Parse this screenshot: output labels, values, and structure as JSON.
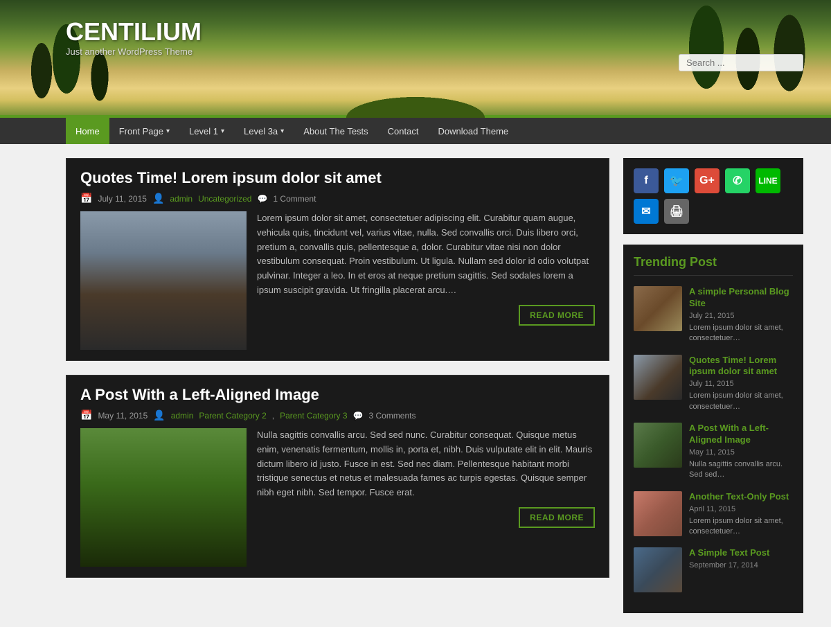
{
  "site": {
    "title": "CENTILIUM",
    "tagline": "Just another WordPress Theme"
  },
  "header": {
    "search_placeholder": "Search ..."
  },
  "nav": {
    "items": [
      {
        "label": "Home",
        "active": true,
        "has_arrow": false
      },
      {
        "label": "Front Page",
        "active": false,
        "has_arrow": true
      },
      {
        "label": "Level 1",
        "active": false,
        "has_arrow": true
      },
      {
        "label": "Level 3a",
        "active": false,
        "has_arrow": true
      },
      {
        "label": "About The Tests",
        "active": false,
        "has_arrow": false
      },
      {
        "label": "Contact",
        "active": false,
        "has_arrow": false
      },
      {
        "label": "Download Theme",
        "active": false,
        "has_arrow": false
      }
    ]
  },
  "posts": [
    {
      "title": "Quotes Time! Lorem ipsum dolor sit amet",
      "date": "July 11, 2015",
      "author": "admin",
      "category": "Uncategorized",
      "comments": "1 Comment",
      "excerpt": "Lorem ipsum dolor sit amet, consectetuer adipiscing elit. Curabitur quam augue, vehicula quis, tincidunt vel, varius vitae, nulla. Sed convallis orci. Duis libero orci, pretium a, convallis quis, pellentesque a, dolor. Curabitur vitae nisi non dolor vestibulum consequat. Proin vestibulum. Ut ligula. Nullam sed dolor id odio volutpat pulvinar. Integer a leo. In et eros at neque pretium sagittis. Sed sodales lorem a ipsum suscipit gravida. Ut fringilla placerat arcu.…",
      "read_more": "READ MORE",
      "image_class": "img-woman"
    },
    {
      "title": "A Post With a Left-Aligned Image",
      "date": "May 11, 2015",
      "author": "admin",
      "category1": "Parent Category 2",
      "category2": "Parent Category 3",
      "comments": "3 Comments",
      "excerpt": "Nulla sagittis convallis arcu. Sed sed nunc. Curabitur consequat. Quisque metus enim, venenatis fermentum, mollis in, porta et, nibh. Duis vulputate elit in elit. Mauris dictum libero id justo. Fusce in est. Sed nec diam. Pellentesque habitant morbi tristique senectus et netus et malesuada fames ac turpis egestas. Quisque semper nibh eget nibh. Sed tempor. Fusce erat.",
      "read_more": "READ MORE",
      "image_class": "img-mother"
    }
  ],
  "sidebar": {
    "trending_title": "Trending Post",
    "trending_items": [
      {
        "title": "A simple Personal Blog Site",
        "date": "July 21, 2015",
        "excerpt": "Lorem ipsum dolor sit amet, consectetuer…",
        "img_class": "t-img-1"
      },
      {
        "title": "Quotes Time! Lorem ipsum dolor sit amet",
        "date": "July 11, 2015",
        "excerpt": "Lorem ipsum dolor sit amet, consectetuer…",
        "img_class": "t-img-2"
      },
      {
        "title": "A Post With a Left-Aligned Image",
        "date": "May 11, 2015",
        "excerpt": "Nulla sagittis convallis arcu. Sed sed…",
        "img_class": "t-img-3"
      },
      {
        "title": "Another Text-Only Post",
        "date": "April 11, 2015",
        "excerpt": "Lorem ipsum dolor sit amet, consectetuer…",
        "img_class": "t-img-4"
      },
      {
        "title": "A Simple Text Post",
        "date": "September 17, 2014",
        "excerpt": "",
        "img_class": "t-img-5"
      }
    ]
  }
}
